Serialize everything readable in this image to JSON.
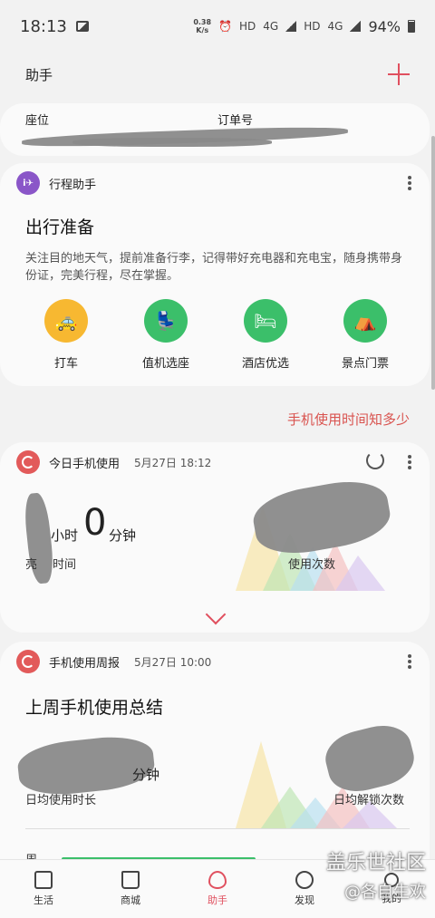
{
  "status_bar": {
    "time": "18:13",
    "net_speed_value": "0.38",
    "net_speed_unit": "K/s",
    "hd1": "HD",
    "g1": "4G",
    "hd2": "HD",
    "g2": "4G",
    "battery": "94%"
  },
  "header": {
    "title": "助手"
  },
  "booking": {
    "seat_label": "座位",
    "order_label": "订单号"
  },
  "trip": {
    "app_name": "行程助手",
    "title": "出行准备",
    "description": "关注目的地天气，提前准备行李，记得带好充电器和充电宝，随身携带身份证，完美行程，尽在掌握。",
    "shortcuts": [
      {
        "label": "打车",
        "icon": "taxi-icon",
        "color": "#f7b831"
      },
      {
        "label": "值机选座",
        "icon": "seat-icon",
        "color": "#3bbf6a"
      },
      {
        "label": "酒店优选",
        "icon": "bed-icon",
        "color": "#3bbf6a"
      },
      {
        "label": "景点门票",
        "icon": "tent-icon",
        "color": "#3bbf6a"
      }
    ]
  },
  "promo_link": "手机使用时间知多少",
  "today_usage": {
    "app_name": "今日手机使用",
    "date": "5月27日 18:12",
    "hours_label": "小时",
    "minutes_value": "0",
    "minutes_label": "分钟",
    "screen_label_visible": "亮",
    "screen_label_rest": "时间",
    "count_label": "使用次数"
  },
  "weekly": {
    "app_name": "手机使用周报",
    "date": "5月27日 10:00",
    "title": "上周手机使用总结",
    "left_label": "日均使用时长",
    "right_label": "日均解锁次数",
    "minutes_label": "分钟",
    "row_label": "周"
  },
  "bottom_nav": [
    {
      "label": "生活"
    },
    {
      "label": "商城"
    },
    {
      "label": "助手"
    },
    {
      "label": "发现"
    },
    {
      "label": "我的"
    }
  ],
  "watermark": {
    "line1": "盖乐世社区",
    "line2": "@各自生欢"
  },
  "colors": {
    "accent": "#e0505f",
    "green": "#3bbf6a",
    "yellow": "#f7b831",
    "purple": "#8a56c8"
  }
}
